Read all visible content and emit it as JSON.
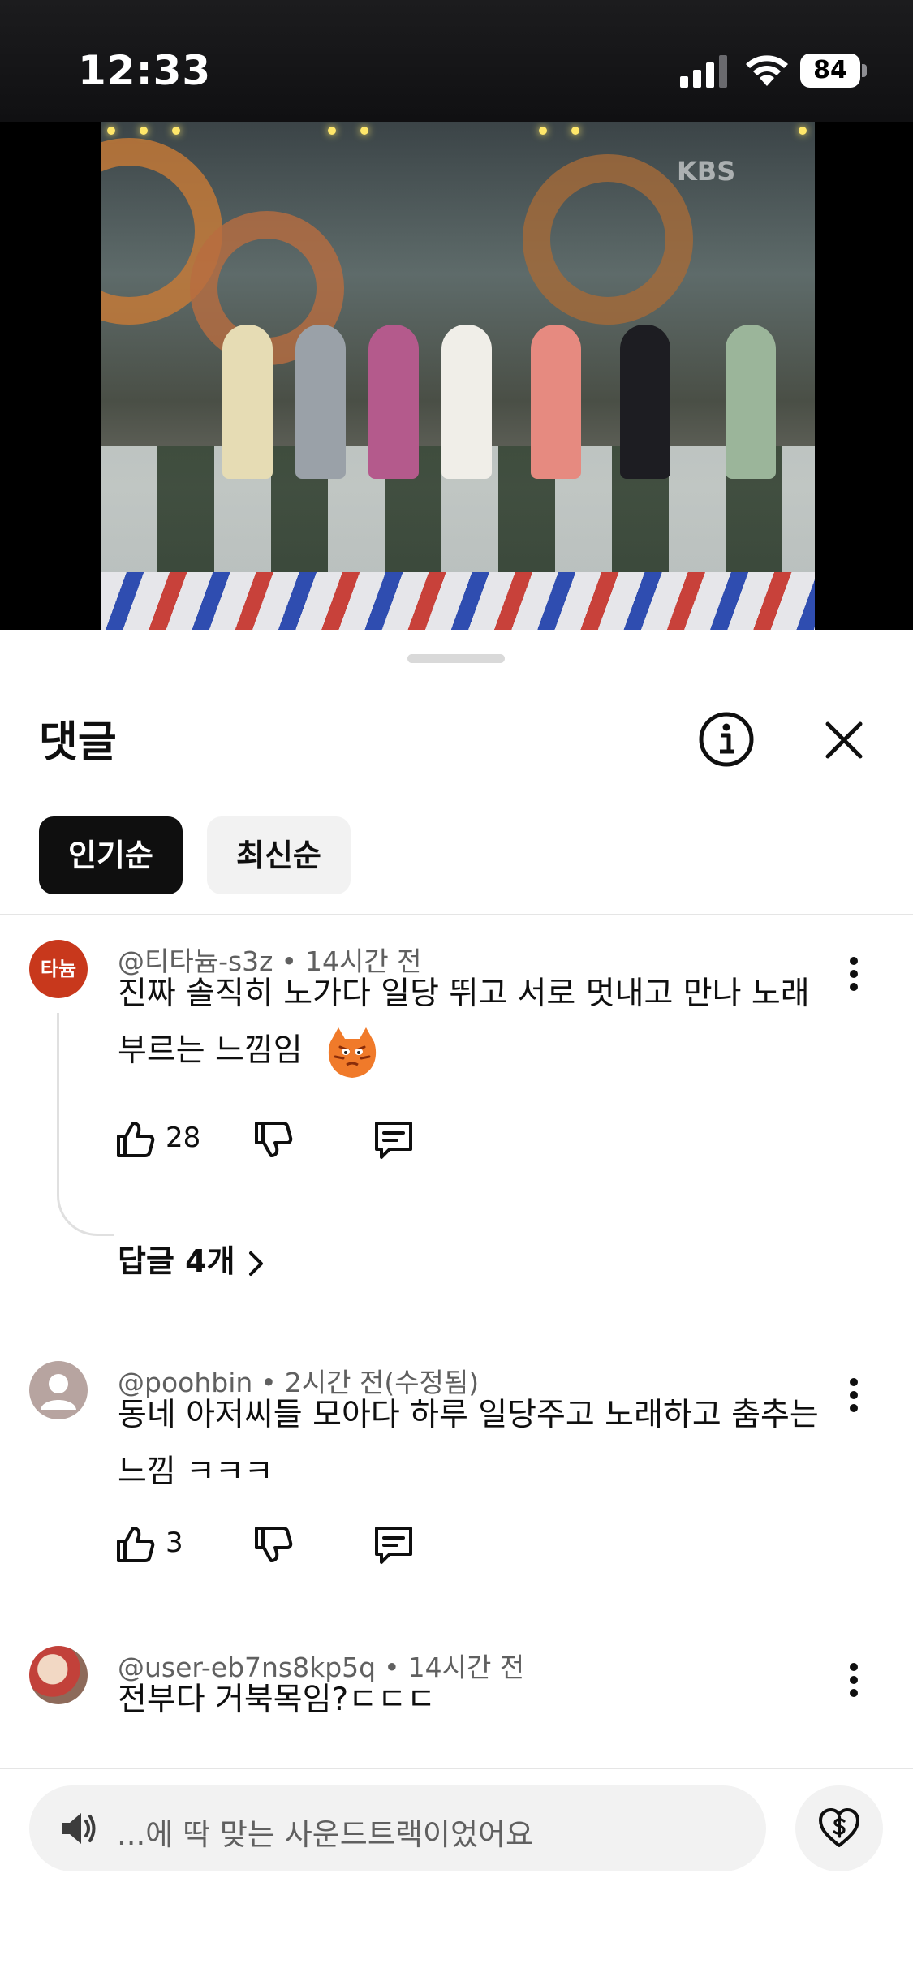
{
  "status_bar": {
    "time": "12:33",
    "battery": "84"
  },
  "video": {
    "channel_logo": "KBS",
    "progress_fraction": 0.08
  },
  "comments_panel": {
    "title": "댓글",
    "sort_chips": [
      {
        "label": "인기순",
        "selected": true
      },
      {
        "label": "최신순",
        "selected": false
      }
    ],
    "comments": [
      {
        "author": "@티타늄-s3z",
        "avatar_text": "타늄",
        "avatar_color": "#c8381c",
        "time": "14시간 전",
        "text": "진짜 솔직히 노가다  일당 뛰고 서로 멋내고 만나 노래 부르는 느낌임",
        "likes": "28",
        "replies": "답글 4개"
      },
      {
        "author": "@poohbin",
        "time": "2시간 전(수정됨)",
        "text": "동네 아저씨들 모아다 하루 일당주고 노래하고 춤추는 느낌 ㅋㅋㅋ",
        "likes": "3"
      },
      {
        "author": "@user-eb7ns8kp5q",
        "time": "14시간 전",
        "text": "전부다 거북목임?ㄷㄷㄷ"
      }
    ],
    "composer": {
      "placeholder": "...에 딱 맞는 사운드트랙이었어요"
    }
  },
  "icons": {
    "info": "info-icon",
    "close": "close-icon",
    "more": "more-vert-icon",
    "like": "thumb-up-icon",
    "dislike": "thumb-down-icon",
    "reply": "reply-icon",
    "chevron": "chevron-right-icon",
    "speaker": "speaker-icon",
    "thanks": "heart-dollar-icon"
  },
  "colors": {
    "accent": "#ff0033",
    "text_primary": "#0f0f0f",
    "text_secondary": "#606060",
    "chip_bg": "#f2f2f2"
  }
}
